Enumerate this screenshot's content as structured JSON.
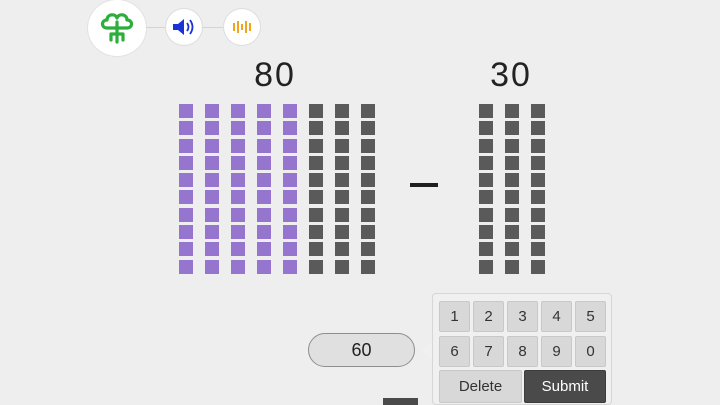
{
  "problem": {
    "left_number": "80",
    "right_number": "30",
    "operator": "−",
    "left_blocks": {
      "total_tens": 8,
      "highlighted_tens": 5,
      "units_per_ten": 10
    },
    "right_blocks": {
      "total_tens": 3,
      "highlighted_tens": 0,
      "units_per_ten": 10
    }
  },
  "answer": {
    "value": "60"
  },
  "keypad": {
    "row1": [
      "1",
      "2",
      "3",
      "4",
      "5"
    ],
    "row2": [
      "6",
      "7",
      "8",
      "9",
      "0"
    ],
    "delete_label": "Delete",
    "submit_label": "Submit"
  },
  "icons": {
    "logo": "tree-logo-icon",
    "speaker": "speaker-icon",
    "audio_wave": "audio-wave-icon"
  },
  "colors": {
    "background": "#eeeeee",
    "highlight_block": "#9575cd",
    "block": "#5a5a5a",
    "logo_green": "#2bae3a",
    "speaker_blue": "#1a33d6",
    "wave_orange": "#f2a51a",
    "submit_bg": "#4a4a4a"
  }
}
